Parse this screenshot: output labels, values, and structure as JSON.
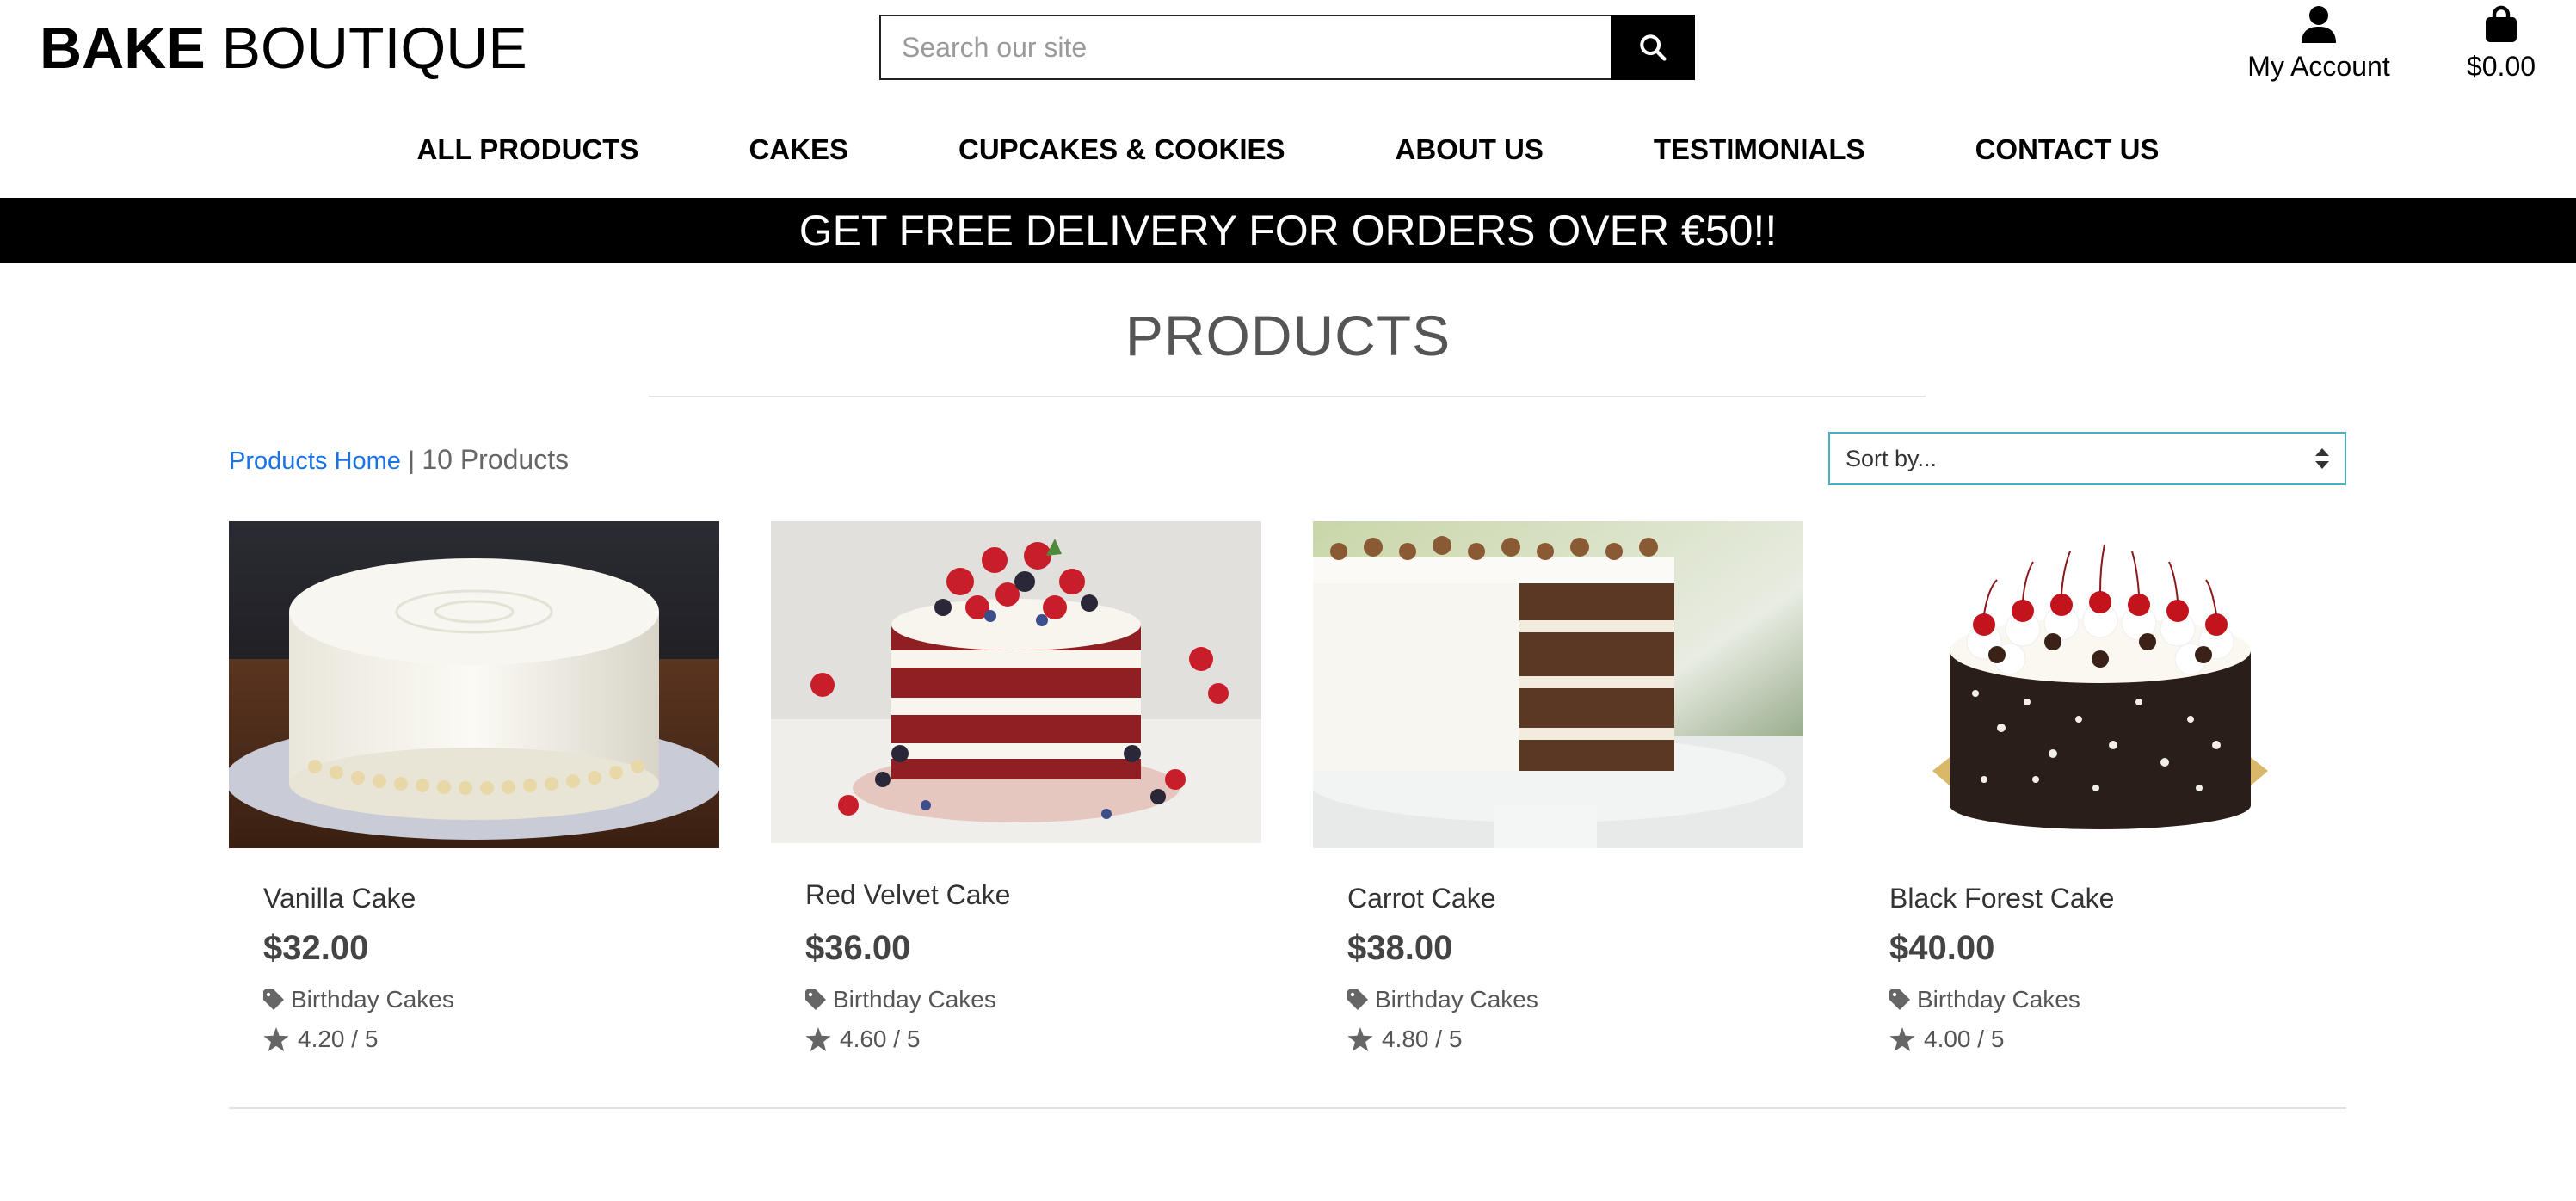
{
  "brand": {
    "bold": "BAKE",
    "light": "BOUTIQUE"
  },
  "search": {
    "placeholder": "Search our site",
    "value": ""
  },
  "account": {
    "label": "My Account",
    "icon": "user-icon"
  },
  "cart": {
    "total": "$0.00",
    "icon": "shopping-bag-icon"
  },
  "nav": [
    "ALL PRODUCTS",
    "CAKES",
    "CUPCAKES & COOKIES",
    "ABOUT US",
    "TESTIMONIALS",
    "CONTACT US"
  ],
  "banner": "GET FREE DELIVERY FOR ORDERS OVER €50!!",
  "page": {
    "title": "PRODUCTS",
    "breadcrumb_link": "Products Home",
    "separator": "|",
    "count_text": "10 Products",
    "sort_label": "Sort by..."
  },
  "products": [
    {
      "name": "Vanilla Cake",
      "price": "$32.00",
      "category": "Birthday Cakes",
      "rating": "4.20 / 5"
    },
    {
      "name": "Red Velvet Cake",
      "price": "$36.00",
      "category": "Birthday Cakes",
      "rating": "4.60 / 5"
    },
    {
      "name": "Carrot Cake",
      "price": "$38.00",
      "category": "Birthday Cakes",
      "rating": "4.80 / 5"
    },
    {
      "name": "Black Forest Cake",
      "price": "$40.00",
      "category": "Birthday Cakes",
      "rating": "4.00 / 5"
    }
  ],
  "colors": {
    "link": "#1a73e8",
    "sort_border": "#4ab0c0",
    "banner_bg": "#000000"
  }
}
